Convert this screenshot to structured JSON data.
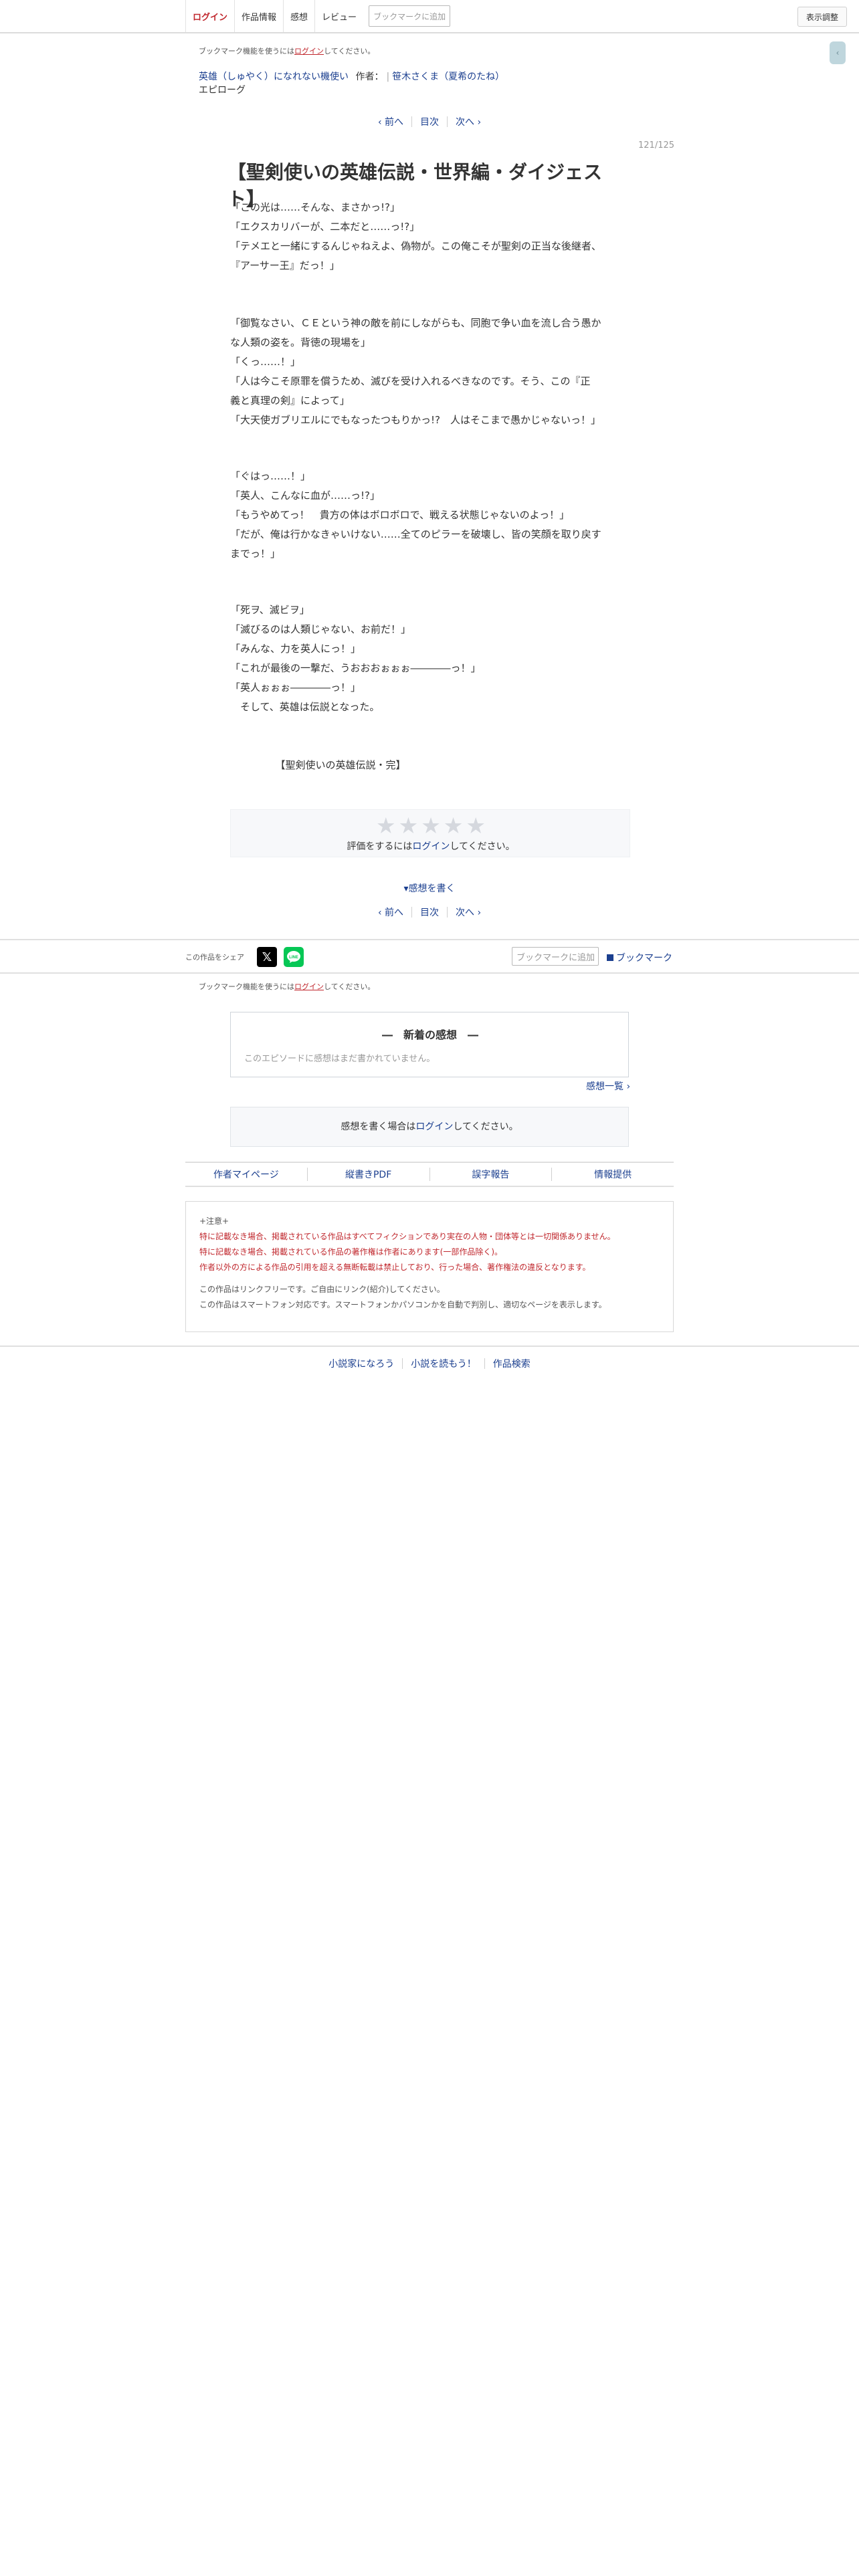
{
  "nav": {
    "login": "ログイン",
    "work_info": "作品情報",
    "impressions": "感想",
    "review": "レビュー",
    "bookmark_add_placeholder": "ブックマークに追加",
    "display_settings": "表示調整",
    "side_tab_icon": "chevron-left-icon"
  },
  "bookmark_notice": {
    "before": "ブックマーク機能を使うには",
    "link": "ログイン",
    "after": "してください。"
  },
  "series": {
    "title": "英雄（しゅやく）になれない機使い",
    "author_label": "作者：",
    "author": "笹木さくま（夏希のたね）",
    "episode_label": "エピローグ"
  },
  "pager": {
    "prev": "‹ 前へ",
    "toc": "目次",
    "next": "次へ ›"
  },
  "page_count": "121/125",
  "chapter_title": "【聖剣使いの英雄伝説・世界編・ダイジェスト】",
  "paragraphs": [
    [
      "「この光は……そんな、まさかっ!?」",
      "「エクスカリバーが、二本だと……っ!?」",
      "「テメエと一緒にするんじゃねえよ、偽物が。この俺こそが聖剣の正当な後継者、",
      "『アーサー王』だっ！」"
    ],
    [
      "「御覧なさい、ＣＥという神の敵を前にしながらも、同胞で争い血を流し合う愚か",
      "な人類の姿を。背徳の現場を」",
      "「くっ……！」",
      "「人は今こそ原罪を償うため、滅びを受け入れるべきなのです。そう、この『正",
      "義と真理の剣』によって」",
      "「大天使ガブリエルにでもなったつもりかっ!?　人はそこまで愚かじゃないっ！」"
    ],
    [
      "「ぐはっ……！」",
      "「英人、こんなに血が……っ!?」",
      "「もうやめてっ！　貴方の体はボロボロで、戦える状態じゃないのよっ！」",
      "「だが、俺は行かなきゃいけない……全てのピラーを破壊し、皆の笑顔を取り戻す",
      "までっ！」"
    ],
    [
      "「死ヲ、滅ビヲ」",
      "「滅びるのは人類じゃない、お前だ！」",
      "「みんな、力を英人にっ！」",
      "「これが最後の一撃だ、うおおおぉぉぉ――――っ！」",
      "「英人ぉぉぉ――――っ！」",
      "　そして、英雄は伝説となった。"
    ],
    [
      "　　　　　【聖剣使いの英雄伝説・完】"
    ]
  ],
  "rating": {
    "stars": 5,
    "filled": 0,
    "msg_before": "評価をするには",
    "msg_link": "ログイン",
    "msg_after": "してください。"
  },
  "write_impression": "▾感想を書く",
  "share": {
    "label": "この作品をシェア",
    "x_icon": "x-logo-icon",
    "line_icon": "line-logo-icon",
    "bookmark_add_placeholder": "ブックマークに追加",
    "bookmark": "ブックマーク"
  },
  "latest": {
    "heading": "―　新着の感想　―",
    "empty": "このエピソードに感想はまだ書かれていません。",
    "list_link": "感想一覧 ›"
  },
  "login_impression": {
    "before": "感想を書く場合は",
    "link": "ログイン",
    "after": "してください。"
  },
  "links": [
    "作者マイページ",
    "縦書きPDF",
    "誤字報告",
    "情報提供"
  ],
  "notes": {
    "title": "+注意+",
    "red": [
      "特に記載なき場合、掲載されている作品はすべてフィクションであり実在の人物・団体等とは一切関係ありません。",
      "特に記載なき場合、掲載されている作品の著作権は作者にあります(一部作品除く)。",
      "作者以外の方による作品の引用を超える無断転載は禁止しており、行った場合、著作権法の違反となります。"
    ],
    "gray": [
      "この作品はリンクフリーです。ご自由にリンク(紹介)してください。",
      "この作品はスマートフォン対応です。スマートフォンかパソコンかを自動で判別し、適切なページを表示します。"
    ]
  },
  "footer": [
    "小説家になろう",
    "小説を読もう！",
    "作品検索"
  ]
}
